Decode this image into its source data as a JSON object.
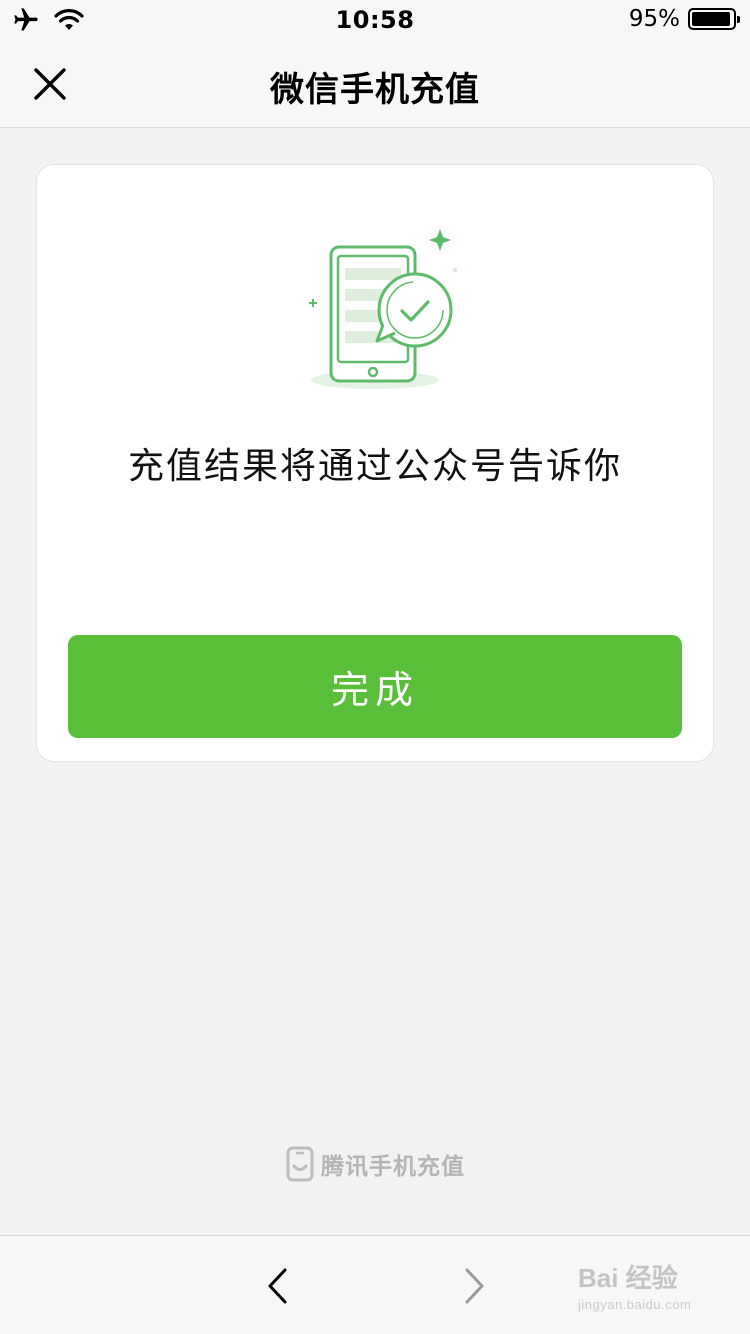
{
  "status_bar": {
    "time": "10:58",
    "battery_percent": "95%",
    "battery_level": 0.95,
    "icons": [
      "airplane-icon",
      "wifi-icon",
      "battery-icon"
    ]
  },
  "nav": {
    "title": "微信手机充值",
    "close_icon": "close-icon"
  },
  "card": {
    "illustration_icon": "phone-check-icon",
    "message": "充值结果将通过公众号告诉你",
    "done_label": "完成"
  },
  "footer": {
    "brand_text": "腾讯手机充值",
    "brand_icon": "phone-smile-icon"
  },
  "toolbar": {
    "back_icon": "chevron-left-icon",
    "forward_icon": "chevron-right-icon"
  },
  "watermark": {
    "logo_text": "Bai 经验",
    "url_text": "jingyan.baidu.com"
  },
  "colors": {
    "accent_green": "#59bf38",
    "illustration_green": "#5dbb6a",
    "background": "#f2f2f2"
  }
}
